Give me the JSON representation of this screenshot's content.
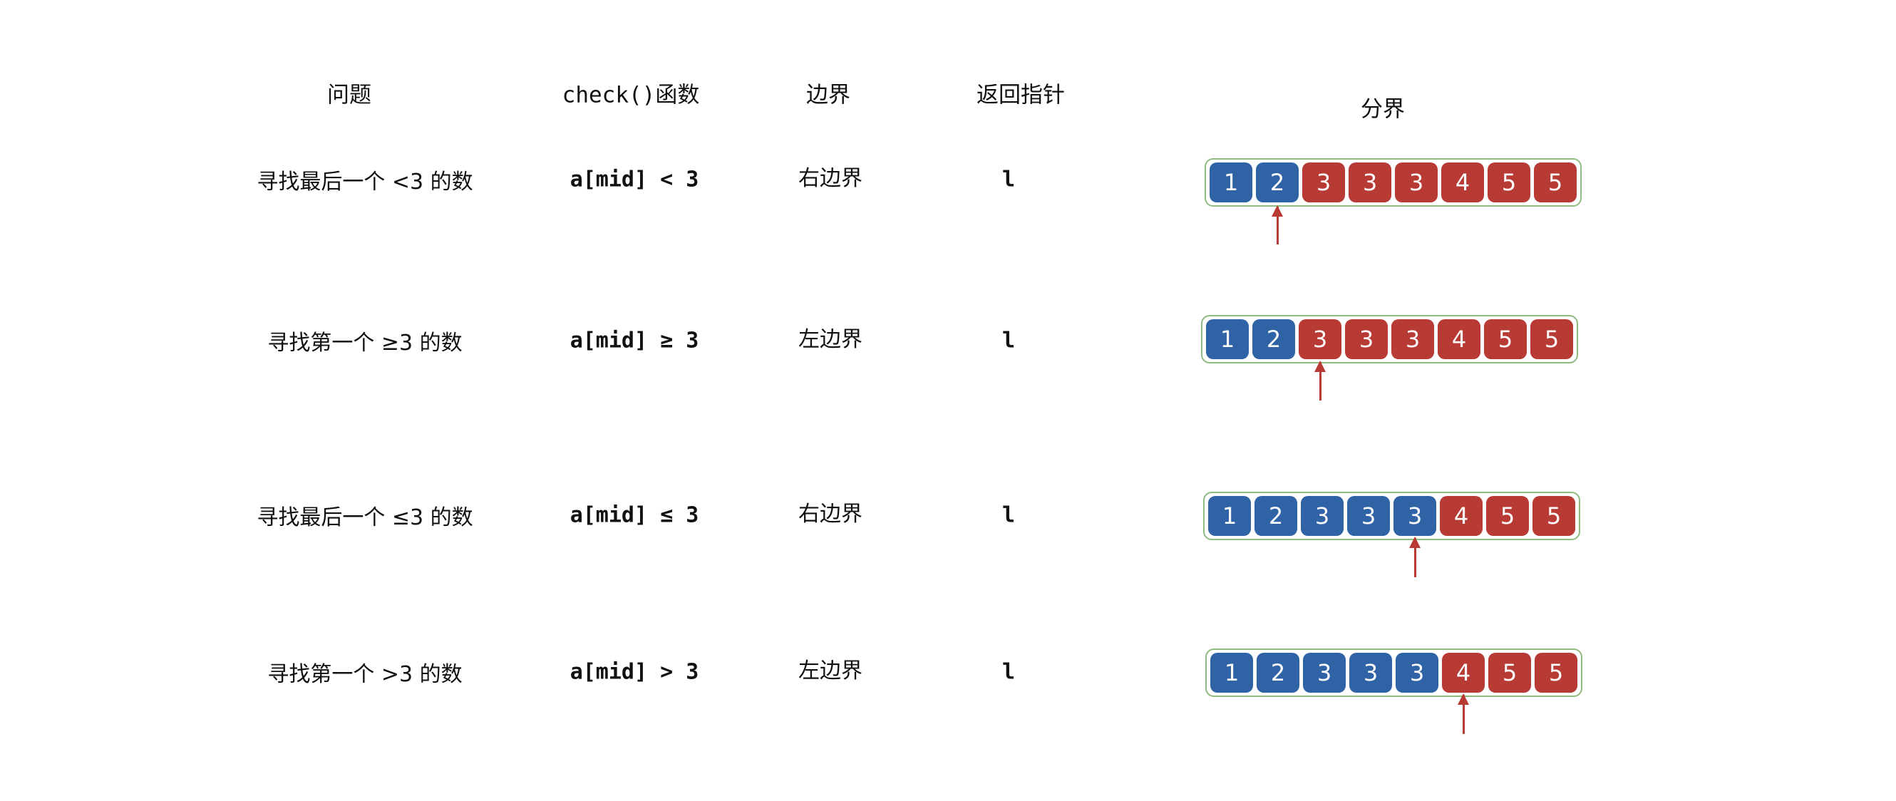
{
  "headers": {
    "problem": "问题",
    "check": "check()函数",
    "boundary": "边界",
    "pointer": "返回指针",
    "split": "分界"
  },
  "colors": {
    "blue": "#2f63a6",
    "red": "#b83a35",
    "border": "#8fbb7f"
  },
  "rows": [
    {
      "problem": "寻找最后一个 <3 的数",
      "check": "a[mid] < 3",
      "boundary": "右边界",
      "pointer": "l",
      "values": [
        1,
        2,
        3,
        3,
        3,
        4,
        5,
        5
      ],
      "blue_count": 2,
      "arrow_index": 1
    },
    {
      "problem": "寻找第一个 ≥3 的数",
      "check": "a[mid] ≥ 3",
      "boundary": "左边界",
      "pointer": "l",
      "values": [
        1,
        2,
        3,
        3,
        3,
        4,
        5,
        5
      ],
      "blue_count": 2,
      "arrow_index": 2
    },
    {
      "problem": "寻找最后一个 ≤3 的数",
      "check": "a[mid] ≤ 3",
      "boundary": "右边界",
      "pointer": "l",
      "values": [
        1,
        2,
        3,
        3,
        3,
        4,
        5,
        5
      ],
      "blue_count": 5,
      "arrow_index": 4
    },
    {
      "problem": "寻找第一个 >3 的数",
      "check": "a[mid] > 3",
      "boundary": "左边界",
      "pointer": "l",
      "values": [
        1,
        2,
        3,
        3,
        3,
        4,
        5,
        5
      ],
      "blue_count": 5,
      "arrow_index": 5
    }
  ]
}
